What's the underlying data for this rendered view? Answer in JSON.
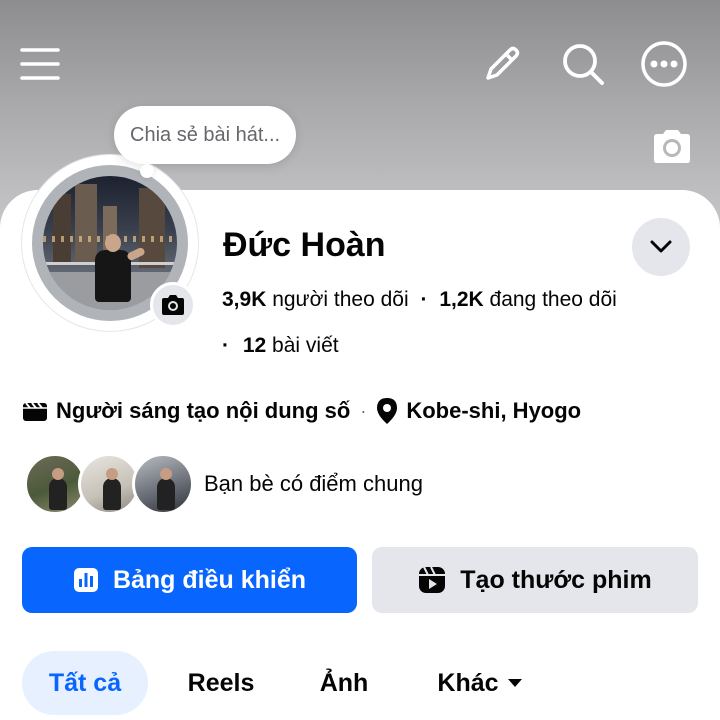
{
  "header": {
    "icons": [
      "menu-icon",
      "pencil-icon",
      "search-icon",
      "more-icon"
    ]
  },
  "song_bubble": {
    "text": "Chia sẻ bài hát..."
  },
  "profile": {
    "name": "Đức Hoàn",
    "followers_count": "3,9K",
    "followers_label": "người theo dõi",
    "following_count": "1,2K",
    "following_label": "đang theo dõi",
    "posts_prefix": "·",
    "posts_count": "12",
    "posts_label": "bài viết",
    "separator": "·"
  },
  "details": {
    "category": "Người sáng tạo nội dung số",
    "location": "Kobe-shi, Hyogo",
    "separator": "·"
  },
  "mutual_friends": {
    "label": "Bạn bè có điểm chung"
  },
  "actions": {
    "dashboard_label": "Bảng điều khiển",
    "create_reel_label": "Tạo thước phim"
  },
  "tabs": [
    {
      "label": "Tất cả",
      "active": true
    },
    {
      "label": "Reels",
      "active": false
    },
    {
      "label": "Ảnh",
      "active": false
    },
    {
      "label": "Khác",
      "active": false
    }
  ],
  "colors": {
    "accent": "#0866ff",
    "secondary_button": "#e4e6eb",
    "active_tab_bg": "#e7f0ff",
    "text": "#050505",
    "muted_text": "#65676b"
  }
}
